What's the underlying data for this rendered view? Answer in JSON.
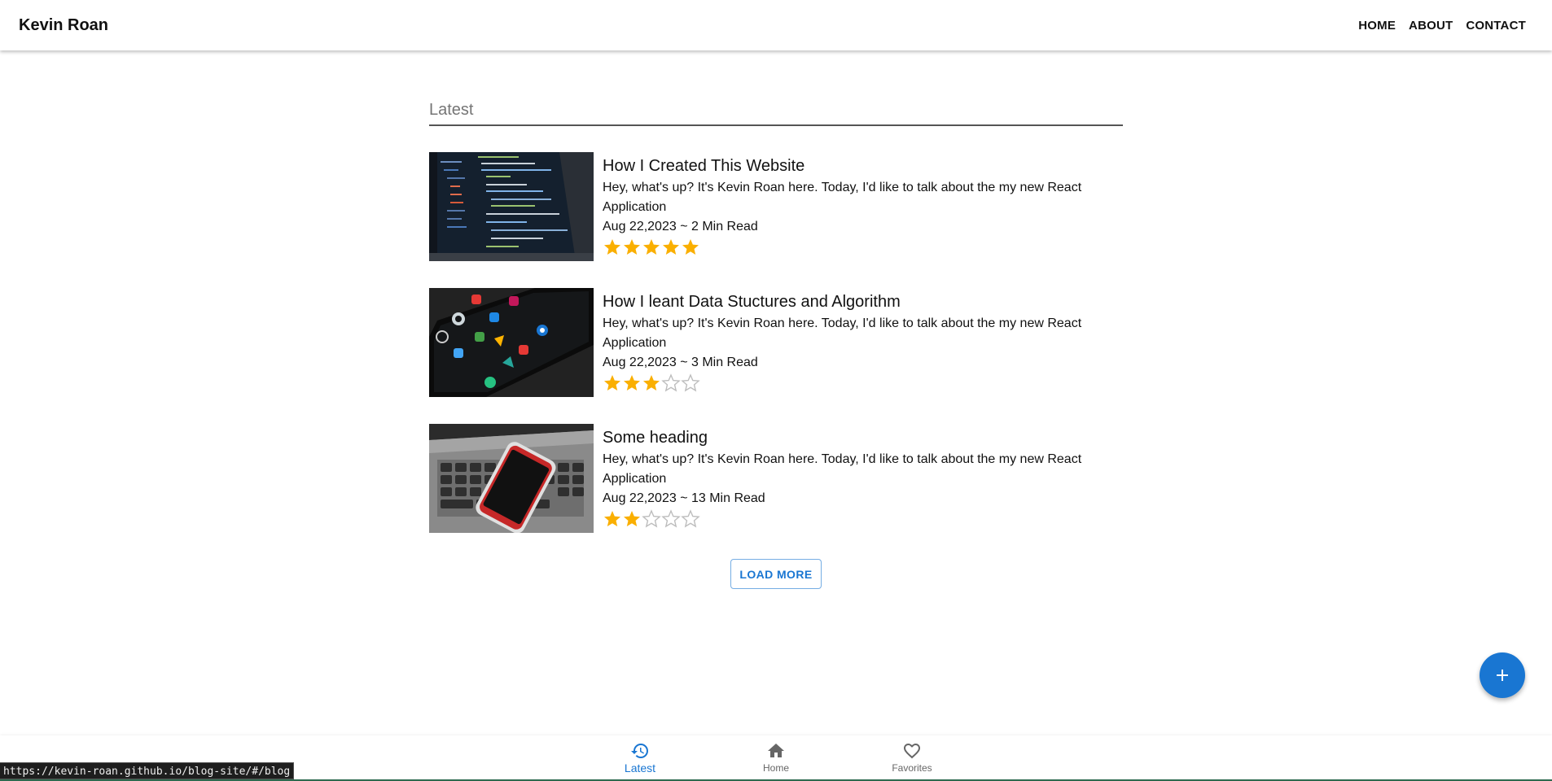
{
  "header": {
    "brand": "Kevin Roan",
    "nav": [
      "HOME",
      "ABOUT",
      "CONTACT"
    ]
  },
  "section": {
    "title": "Latest"
  },
  "posts": [
    {
      "title": "How I Created This Website",
      "excerpt": "Hey, what's up? It's Kevin Roan here. Today, I'd like to talk about the my new React Application",
      "meta": "Aug 22,2023 ~ 2 Min Read",
      "rating": 5,
      "image": "laptop-code"
    },
    {
      "title": "How I leant Data Stuctures and Algorithm",
      "excerpt": "Hey, what's up? It's Kevin Roan here. Today, I'd like to talk about the my new React Application",
      "meta": "Aug 22,2023 ~ 3 Min Read",
      "rating": 3,
      "image": "phone-apps"
    },
    {
      "title": "Some heading",
      "excerpt": "Hey, what's up? It's Kevin Roan here. Today, I'd like to talk about the my new React Application",
      "meta": "Aug 22,2023 ~ 13 Min Read",
      "rating": 2,
      "image": "phone-on-laptop"
    }
  ],
  "rating_max": 5,
  "load_more_label": "LOAD MORE",
  "fab": {
    "icon": "plus-icon"
  },
  "bottom_nav": [
    {
      "label": "Latest",
      "icon": "history-icon",
      "active": true
    },
    {
      "label": "Home",
      "icon": "home-icon",
      "active": false
    },
    {
      "label": "Favorites",
      "icon": "heart-outline-icon",
      "active": false
    }
  ],
  "status_url": "https://kevin-roan.github.io/blog-site/#/blog",
  "colors": {
    "primary": "#1976d2",
    "star": "#faaf00",
    "star_empty": "#bdbdbd"
  }
}
